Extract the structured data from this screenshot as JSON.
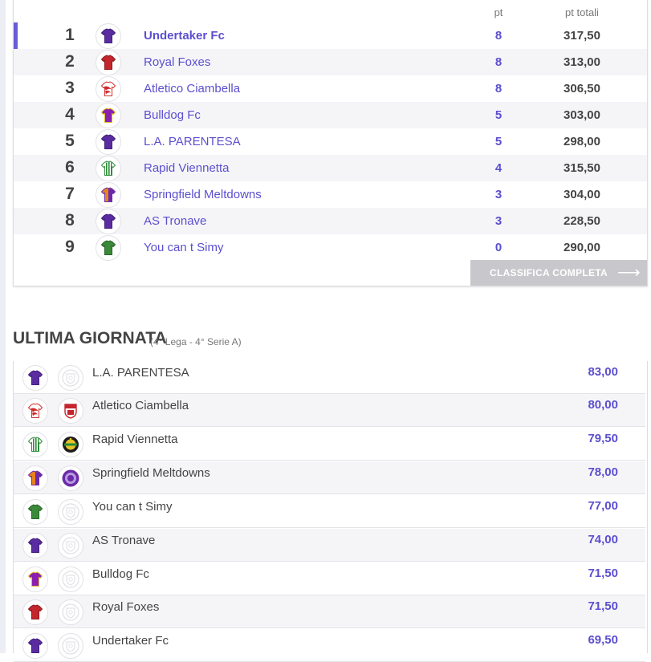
{
  "colors": {
    "accent": "#5b4fcf",
    "button_bg": "#c8c8cc",
    "row_alt": "#f5f5f8"
  },
  "standings": {
    "header_pt": "pt",
    "header_total": "pt totali",
    "rows": [
      {
        "rank": "1",
        "team": "Undertaker Fc",
        "pt": "8",
        "total": "317,50",
        "jersey": "purple-jersey-icon"
      },
      {
        "rank": "2",
        "team": "Royal Foxes",
        "pt": "8",
        "total": "313,00",
        "jersey": "red-jersey-icon"
      },
      {
        "rank": "3",
        "team": "Atletico Ciambella",
        "pt": "8",
        "total": "306,50",
        "jersey": "red-white-jersey-icon"
      },
      {
        "rank": "4",
        "team": "Bulldog Fc",
        "pt": "5",
        "total": "303,00",
        "jersey": "purple-jersey-icon"
      },
      {
        "rank": "5",
        "team": "L.A. PARENTESA",
        "pt": "5",
        "total": "298,00",
        "jersey": "purple-jersey-icon"
      },
      {
        "rank": "6",
        "team": "Rapid Viennetta",
        "pt": "4",
        "total": "315,50",
        "jersey": "green-striped-jersey-icon"
      },
      {
        "rank": "7",
        "team": "Springfield Meltdowns",
        "pt": "3",
        "total": "304,00",
        "jersey": "orange-purple-jersey-icon"
      },
      {
        "rank": "8",
        "team": "AS Tronave",
        "pt": "3",
        "total": "228,50",
        "jersey": "purple-jersey-icon"
      },
      {
        "rank": "9",
        "team": "You can t Simy",
        "pt": "0",
        "total": "290,00",
        "jersey": "green-jersey-icon"
      }
    ],
    "button_label": "CLASSIFICA COMPLETA",
    "button_arrow": "⟶"
  },
  "last_matchday": {
    "title": "ULTIMA GIORNATA",
    "subtitle": "(4° Lega - 4° Serie A)",
    "rows": [
      {
        "team": "L.A. PARENTESA",
        "score": "83,00",
        "jersey": "purple-jersey-icon",
        "logo": "placeholder-crest-icon"
      },
      {
        "team": "Atletico Ciambella",
        "score": "80,00",
        "jersey": "red-white-jersey-icon",
        "logo": "club-crest-icon"
      },
      {
        "team": "Rapid Viennetta",
        "score": "79,50",
        "jersey": "green-striped-jersey-icon",
        "logo": "club-crest-icon"
      },
      {
        "team": "Springfield Meltdowns",
        "score": "78,00",
        "jersey": "orange-purple-jersey-icon",
        "logo": "club-crest-icon"
      },
      {
        "team": "You can t Simy",
        "score": "77,00",
        "jersey": "green-jersey-icon",
        "logo": "placeholder-crest-icon"
      },
      {
        "team": "AS Tronave",
        "score": "74,00",
        "jersey": "purple-jersey-icon",
        "logo": "placeholder-crest-icon"
      },
      {
        "team": "Bulldog Fc",
        "score": "71,50",
        "jersey": "purple-jersey-icon",
        "logo": "placeholder-crest-icon"
      },
      {
        "team": "Royal Foxes",
        "score": "71,50",
        "jersey": "red-jersey-icon",
        "logo": "placeholder-crest-icon"
      },
      {
        "team": "Undertaker Fc",
        "score": "69,50",
        "jersey": "purple-jersey-icon",
        "logo": "placeholder-crest-icon"
      }
    ]
  }
}
